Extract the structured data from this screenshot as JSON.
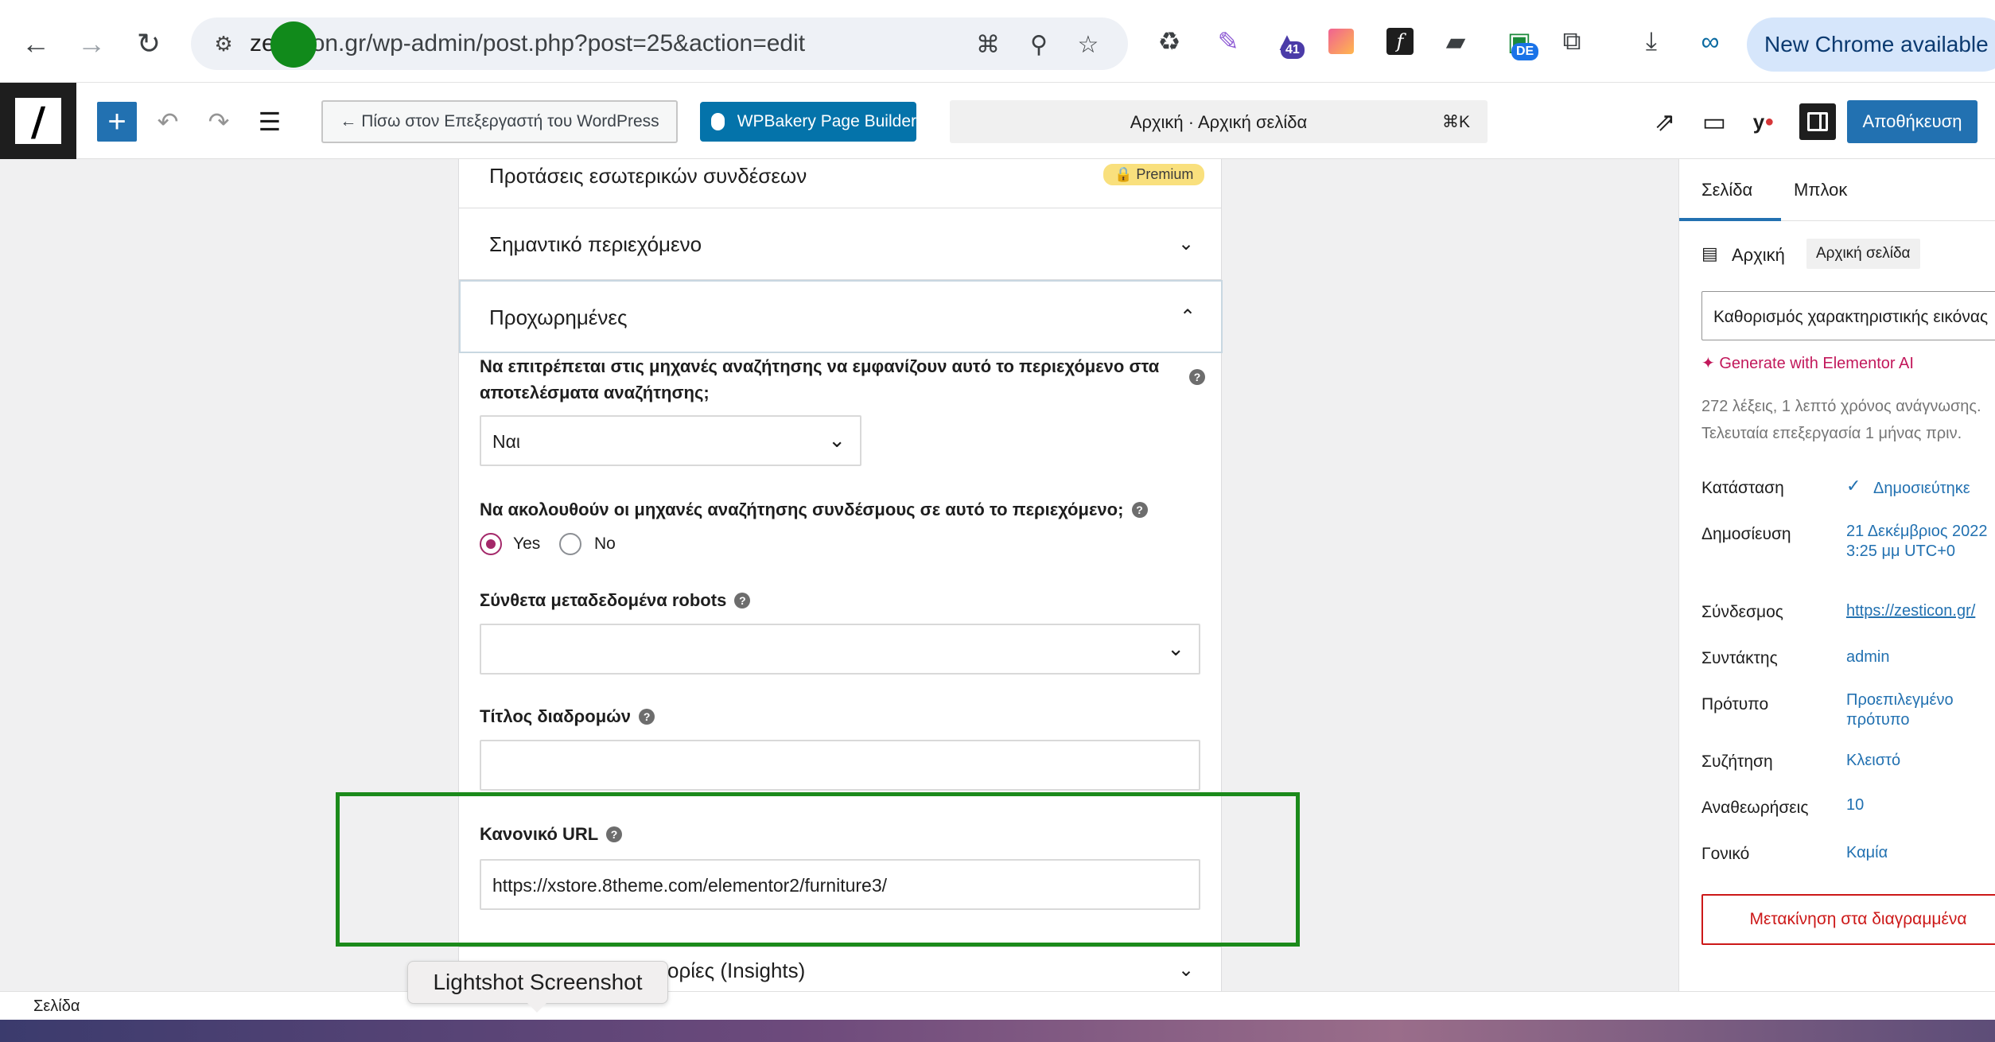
{
  "browser": {
    "url_prefix": "ze",
    "url_rest": "on.gr/wp-admin/post.php?post=25&action=edit",
    "new_chrome_label": "New Chrome available",
    "ext_badge_count": "41",
    "ext_badge_de": "DE"
  },
  "editor_header": {
    "back_label": "← Πίσω στον Επεξεργαστή του WordPress",
    "wpbakery_label": "WPBakery Page Builder",
    "doc_title": "Αρχική · Αρχική σελίδα",
    "shortcut": "⌘K",
    "save_label": "Αποθήκευση"
  },
  "panel": {
    "internal_links_label": "Προτάσεις εσωτερικών συνδέσεων",
    "premium_label": "🔒 Premium",
    "cornerstone_label": "Σημαντικό περιεχόμενο",
    "advanced_label": "Προχωρημένες",
    "allow_search_label": "Να επιτρέπεται στις μηχανές αναζήτησης να εμφανίζουν αυτό το περιεχόμενο στα αποτελέσματα αναζήτησης;",
    "allow_search_value": "Ναι",
    "follow_links_label": "Να ακολουθούν οι μηχανές αναζήτησης συνδέσμους σε αυτό το περιεχόμενο;",
    "radio_yes": "Yes",
    "radio_no": "No",
    "robots_label": "Σύνθετα μεταδεδομένα robots",
    "breadcrumbs_title_label": "Τίτλος διαδρομών",
    "canonical_label": "Κανονικό URL",
    "canonical_value": "https://xstore.8theme.com/elementor2/furniture3/",
    "insights_label": "ορίες (Insights)",
    "help_glyph": "?"
  },
  "sidebar": {
    "tab_page": "Σελίδα",
    "tab_block": "Μπλοκ",
    "page_name": "Αρχική",
    "template_chip": "Αρχική σελίδα",
    "featured_image": "Καθορισμός χαρακτηριστικής εικόνας",
    "elementor_ai": "✦ Generate with Elementor AI",
    "words_info": "272 λέξεις, 1 λεπτό χρόνος ανάγνωσης.",
    "last_edit": "Τελευταία επεξεργασία 1 μήνας πριν.",
    "rows": [
      {
        "label": "Κατάσταση",
        "value": "Δημοσιεύτηκε"
      },
      {
        "label": "Δημοσίευση",
        "value": "21 Δεκέμβριος 2022 3:25 μμ UTC+0"
      },
      {
        "label": "Σύνδεσμος",
        "value": "https://zesticon.gr/"
      },
      {
        "label": "Συντάκτης",
        "value": "admin"
      },
      {
        "label": "Πρότυπο",
        "value": "Προεπιλεγμένο πρότυπο"
      },
      {
        "label": "Συζήτηση",
        "value": "Κλειστό"
      },
      {
        "label": "Αναθεωρήσεις",
        "value": "10"
      },
      {
        "label": "Γονικό",
        "value": "Καμία"
      }
    ],
    "trash_label": "Μετακίνηση στα διαγραμμένα"
  },
  "footer": {
    "breadcrumb": "Σελίδα"
  },
  "tooltip": {
    "label": "Lightshot Screenshot"
  },
  "colors": {
    "wp_blue": "#2271b1",
    "highlight_green": "#1b8a1b",
    "radio_accent": "#a4286a",
    "trash_red": "#cc1818"
  }
}
